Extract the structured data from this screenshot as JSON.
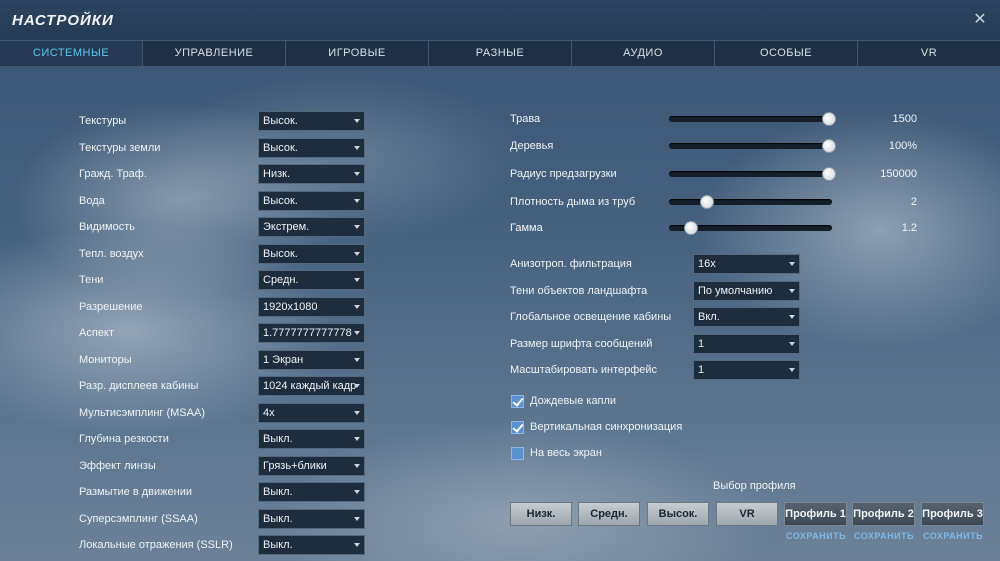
{
  "window": {
    "title": "НАСТРОЙКИ",
    "close_icon": "close-icon"
  },
  "tabs": [
    {
      "label": "СИСТЕМНЫЕ",
      "active": true
    },
    {
      "label": "УПРАВЛЕНИЕ"
    },
    {
      "label": "ИГРОВЫЕ"
    },
    {
      "label": "РАЗНЫЕ"
    },
    {
      "label": "АУДИО"
    },
    {
      "label": "ОСОБЫЕ"
    },
    {
      "label": "VR"
    }
  ],
  "left_settings": [
    {
      "label": "Текстуры",
      "value": "Высок."
    },
    {
      "label": "Текстуры земли",
      "value": "Высок."
    },
    {
      "label": "Гражд. Траф.",
      "value": "Низк."
    },
    {
      "label": "Вода",
      "value": "Высок."
    },
    {
      "label": "Видимость",
      "value": "Экстрем."
    },
    {
      "label": "Тепл. воздух",
      "value": "Высок."
    },
    {
      "label": "Тени",
      "value": "Средн."
    },
    {
      "label": "Разрешение",
      "value": "1920x1080"
    },
    {
      "label": "Аспект",
      "value": "1.7777777777778"
    },
    {
      "label": "Мониторы",
      "value": "1 Экран"
    },
    {
      "label": "Разр. дисплеев кабины",
      "value": "1024 каждый кадр"
    },
    {
      "label": "Мультисэмплинг (MSAA)",
      "value": "4x"
    },
    {
      "label": "Глубина резкости",
      "value": "Выкл."
    },
    {
      "label": "Эффект линзы",
      "value": "Грязь+блики"
    },
    {
      "label": "Размытие в движении",
      "value": "Выкл."
    },
    {
      "label": "Суперсэмплинг (SSAA)",
      "value": "Выкл."
    },
    {
      "label": "Локальные отражения (SSLR)",
      "value": "Выкл."
    }
  ],
  "sliders": [
    {
      "label": "Трава",
      "value": "1500",
      "level": 1.0
    },
    {
      "label": "Деревья",
      "value": "100%",
      "level": 1.0
    },
    {
      "label": "Радиус предзагрузки",
      "value": "150000",
      "level": 1.0
    },
    {
      "label": "Плотность дыма из труб",
      "value": "2",
      "level": 0.2
    },
    {
      "label": "Гамма",
      "value": "1.2",
      "level": 0.1
    }
  ],
  "right_dropdowns": [
    {
      "label": "Анизотроп. фильтрация",
      "value": "16x"
    },
    {
      "label": "Тени объектов ландшафта",
      "value": "По умолчанию"
    },
    {
      "label": "Глобальное освещение кабины",
      "value": "Вкл."
    },
    {
      "label": "Размер шрифта сообщений",
      "value": "1"
    },
    {
      "label": "Масштабировать интерфейс",
      "value": "1"
    }
  ],
  "checkboxes": [
    {
      "label": "Дождевые капли",
      "checked": true
    },
    {
      "label": "Вертикальная синхронизация",
      "checked": true
    },
    {
      "label": "На весь экран",
      "checked": false
    }
  ],
  "profile": {
    "title": "Выбор профиля",
    "presets": [
      "Низк.",
      "Средн.",
      "Высок.",
      "VR"
    ],
    "custom": [
      "Профиль 1",
      "Профиль 2",
      "Профиль 3"
    ],
    "save_label": "СОХРАНИТЬ"
  },
  "colors": {
    "accent": "#5ec6f0",
    "checkbox": "#5a8fd0"
  }
}
